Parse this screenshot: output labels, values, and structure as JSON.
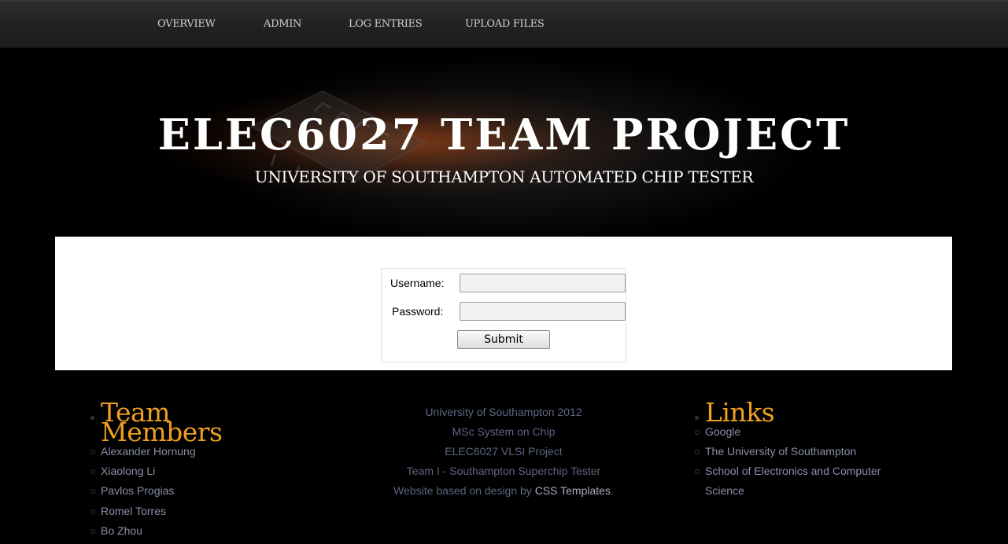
{
  "nav": {
    "items": [
      "OVERVIEW",
      "ADMIN",
      "LOG ENTRIES",
      "UPLOAD FILES"
    ]
  },
  "banner": {
    "title": "ELEC6027 TEAM PROJECT",
    "subtitle": "UNIVERSITY OF SOUTHAMPTON AUTOMATED CHIP TESTER"
  },
  "login": {
    "username_label": "Username:",
    "password_label": "Password:",
    "username_value": "",
    "password_value": "",
    "submit_label": "Submit"
  },
  "footer": {
    "team": {
      "title_line1": "Team",
      "title_line2": "Members",
      "members": [
        "Alexander Hornung",
        "Xiaolong Li",
        "Pavlos Progias",
        "Romel Torres",
        "Bo Zhou"
      ]
    },
    "center": {
      "lines": [
        "University of Southampton 2012",
        "MSc System on Chip",
        "ELEC6027 VLSI Project",
        "Team I - Southampton Superchip Tester"
      ],
      "credit_prefix": "Website based on design by ",
      "credit_link": "CSS Templates",
      "credit_suffix": "."
    },
    "links": {
      "title": "Links",
      "items": [
        "Google",
        "The University of Southampton",
        "School of Electronics and Computer",
        "Science"
      ]
    }
  },
  "colors": {
    "accent": "#f0a020",
    "footer_text": "#8a8fa8",
    "content_bg": "#ffffff"
  }
}
